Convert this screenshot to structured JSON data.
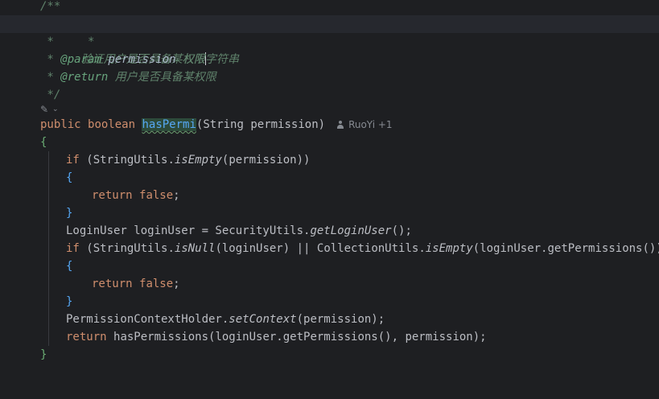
{
  "editor": {
    "doc": {
      "open": "/**",
      "star": " *",
      "desc": "验证用户是否具备某权限",
      "param_tag": "@param",
      "param_name": "permission",
      "param_desc": "权限字符串",
      "return_tag": "@return",
      "return_desc": "用户是否具备某权限",
      "close": " */"
    },
    "sig": {
      "kw_public": "public",
      "kw_boolean": "boolean",
      "method": "hasPermi",
      "params": "(String permission)",
      "author": "RuoYi +1"
    },
    "body": {
      "open_brace": "{",
      "close_brace": "}",
      "if1_kw": "if",
      "if1_a": "(StringUtils.",
      "if1_fn": "isEmpty",
      "if1_b": "(permission))",
      "ret_kw": "return",
      "false_kw": "false",
      "semi": ";",
      "login_a": "LoginUser loginUser = SecurityUtils.",
      "login_fn": "getLoginUser",
      "login_b": "();",
      "if2_kw": "if",
      "if2_a": "(StringUtils.",
      "if2_fn1": "isNull",
      "if2_b": "(loginUser) || CollectionUtils.",
      "if2_fn2": "isEmpty",
      "if2_c": "(loginUser.getPermissions()))",
      "ctx_a": "PermissionContextHolder.",
      "ctx_fn": "setContext",
      "ctx_b": "(permission);",
      "final_a": "hasPermissions(loginUser.getPermissions(), permission);"
    },
    "colors": {
      "background": "#1e1f22",
      "keyword": "#cf8e6d",
      "doc_comment": "#5f826b",
      "function": "#56a8f5"
    }
  }
}
